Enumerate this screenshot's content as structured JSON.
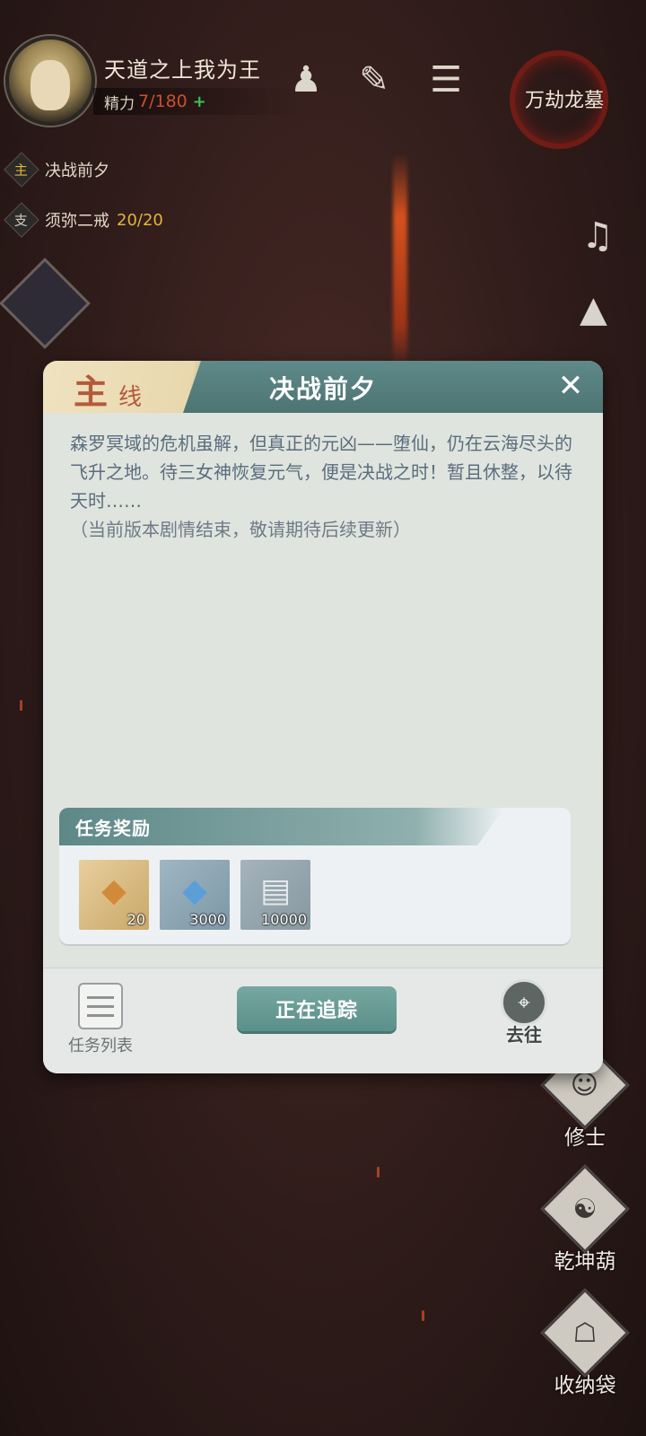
{
  "player": {
    "nickname": "天道之上我为王",
    "energy_label": "精力",
    "energy_value": "7/180",
    "energy_plus": "+"
  },
  "map_button": {
    "label": "万劫龙墓"
  },
  "quest_tracker": {
    "main": {
      "badge": "主",
      "name": "决战前夕"
    },
    "side": {
      "badge": "支",
      "name": "须弥二戒",
      "progress": "20/20"
    }
  },
  "right_menu": [
    {
      "label": "修士",
      "icon": "cultivator-icon"
    },
    {
      "label": "乾坤葫",
      "icon": "gourd-icon"
    },
    {
      "label": "收纳袋",
      "icon": "bag-icon"
    }
  ],
  "dialog": {
    "tab_big": "主",
    "tab_small": "线",
    "title": "决战前夕",
    "body": "森罗冥域的危机虽解，但真正的元凶——堕仙，仍在云海尽头的飞升之地。待三女神恢复元气，便是决战之时！暂且休整，以待天时……",
    "note": "（当前版本剧情结束，敬请期待后续更新）",
    "rewards_title": "任务奖励",
    "rewards": [
      {
        "icon": "spirit-stone-icon",
        "count": "20"
      },
      {
        "icon": "blue-crystal-icon",
        "count": "3000"
      },
      {
        "icon": "scroll-icon",
        "count": "10000"
      }
    ],
    "list_label": "任务列表",
    "track_label": "正在追踪",
    "goto_label": "去往"
  },
  "colors": {
    "header_teal": "#4c7473",
    "energy_red": "#c9502e",
    "progress_gold": "#e0b43c",
    "body_text": "#5b6d7e"
  }
}
